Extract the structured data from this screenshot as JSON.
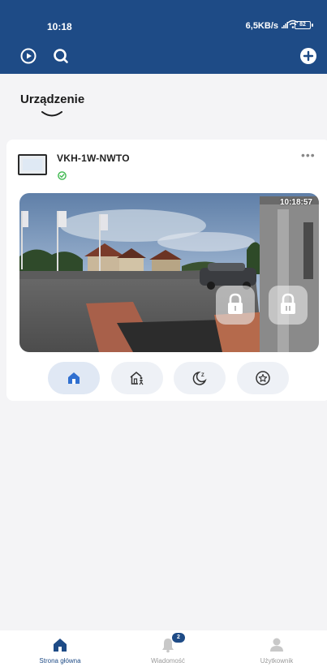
{
  "status_bar": {
    "time": "10:18",
    "network": "6,5KB/s",
    "battery": "82"
  },
  "header": {
    "left_icons": [
      "play-circle-icon",
      "search-icon"
    ],
    "right_icon": "plus-circle-icon",
    "color": "#1e4b86"
  },
  "section": {
    "title": "Urządzenie"
  },
  "device": {
    "name": "VKH-1W-NWTO",
    "status": "online",
    "status_color": "#3fb950",
    "more_label": "•••",
    "camera_timestamp": "10:18:57",
    "lock_buttons": [
      "lock-1",
      "lock-2"
    ],
    "modes": [
      {
        "name": "home",
        "icon": "home-icon",
        "active": true
      },
      {
        "name": "away",
        "icon": "away-house-icon",
        "active": false
      },
      {
        "name": "sleep",
        "icon": "moon-sleep-icon",
        "active": false
      },
      {
        "name": "custom",
        "icon": "star-circle-icon",
        "active": false
      }
    ]
  },
  "bottom_nav": {
    "items": [
      {
        "label": "Strona główna",
        "icon": "home-icon",
        "active": true
      },
      {
        "label": "Wiadomość",
        "icon": "bell-icon",
        "active": false,
        "badge": "2"
      },
      {
        "label": "Użytkownik",
        "icon": "user-icon",
        "active": false
      }
    ],
    "active_color": "#1e4b86"
  }
}
